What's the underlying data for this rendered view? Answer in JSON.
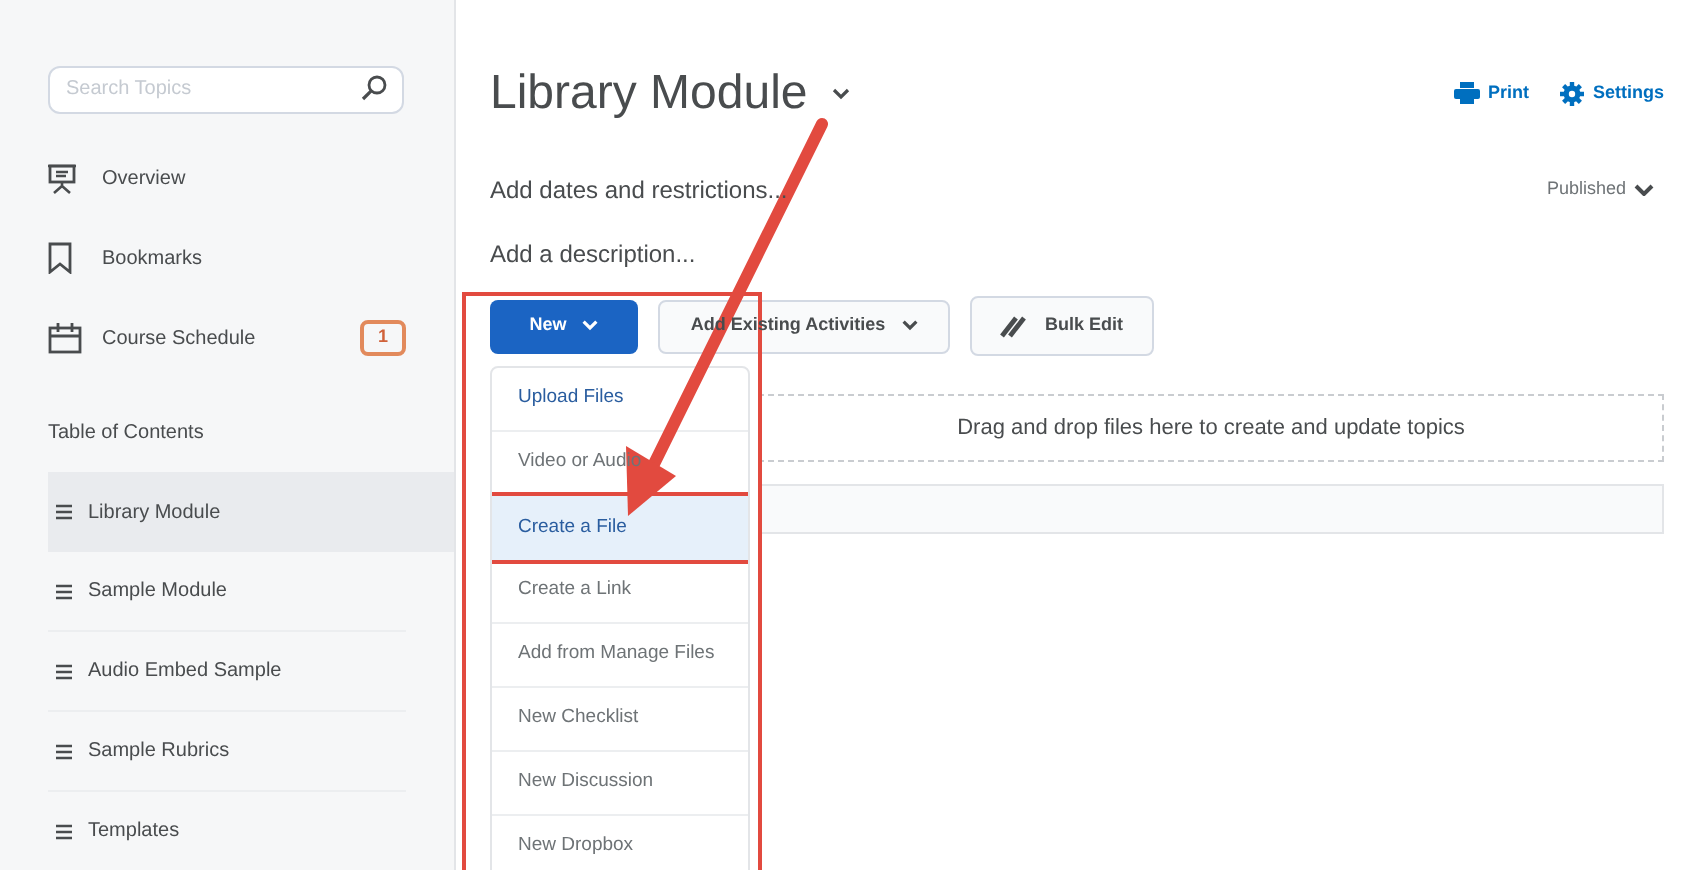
{
  "sidebar": {
    "search": {
      "placeholder": "Search Topics"
    },
    "links": [
      {
        "kind": "overview",
        "label": "Overview"
      },
      {
        "kind": "bookmarks",
        "label": "Bookmarks"
      },
      {
        "kind": "schedule",
        "label": "Course Schedule",
        "badge": "1"
      }
    ],
    "toc_heading": "Table of Contents",
    "modules": [
      {
        "label": "Library Module",
        "selected": true
      },
      {
        "label": "Sample Module",
        "selected": false
      },
      {
        "label": "Audio Embed Sample",
        "selected": false
      },
      {
        "label": "Sample Rubrics",
        "selected": false
      },
      {
        "label": "Templates",
        "selected": false
      }
    ]
  },
  "header": {
    "title": "Library Module",
    "actions": [
      "Print",
      "Settings"
    ]
  },
  "add_dates": "Add dates and restrictions...",
  "status": "Published",
  "add_description": "Add a description...",
  "toolbar": {
    "new_button": "New",
    "existing_button": "Add Existing Activities",
    "bulk_edit": "Bulk Edit"
  },
  "new_menu": [
    {
      "label": "Upload Files",
      "selected": false
    },
    {
      "label": "Video or Audio",
      "selected": false
    },
    {
      "label": "Create a File",
      "selected": true
    },
    {
      "label": "Create a Link",
      "selected": false
    },
    {
      "label": "Add from Manage Files",
      "selected": false
    },
    {
      "label": "New Checklist",
      "selected": false
    },
    {
      "label": "New Discussion",
      "selected": false
    },
    {
      "label": "New Dropbox",
      "selected": false
    }
  ],
  "drop_zone": "Drag and drop files here to create and update topics"
}
